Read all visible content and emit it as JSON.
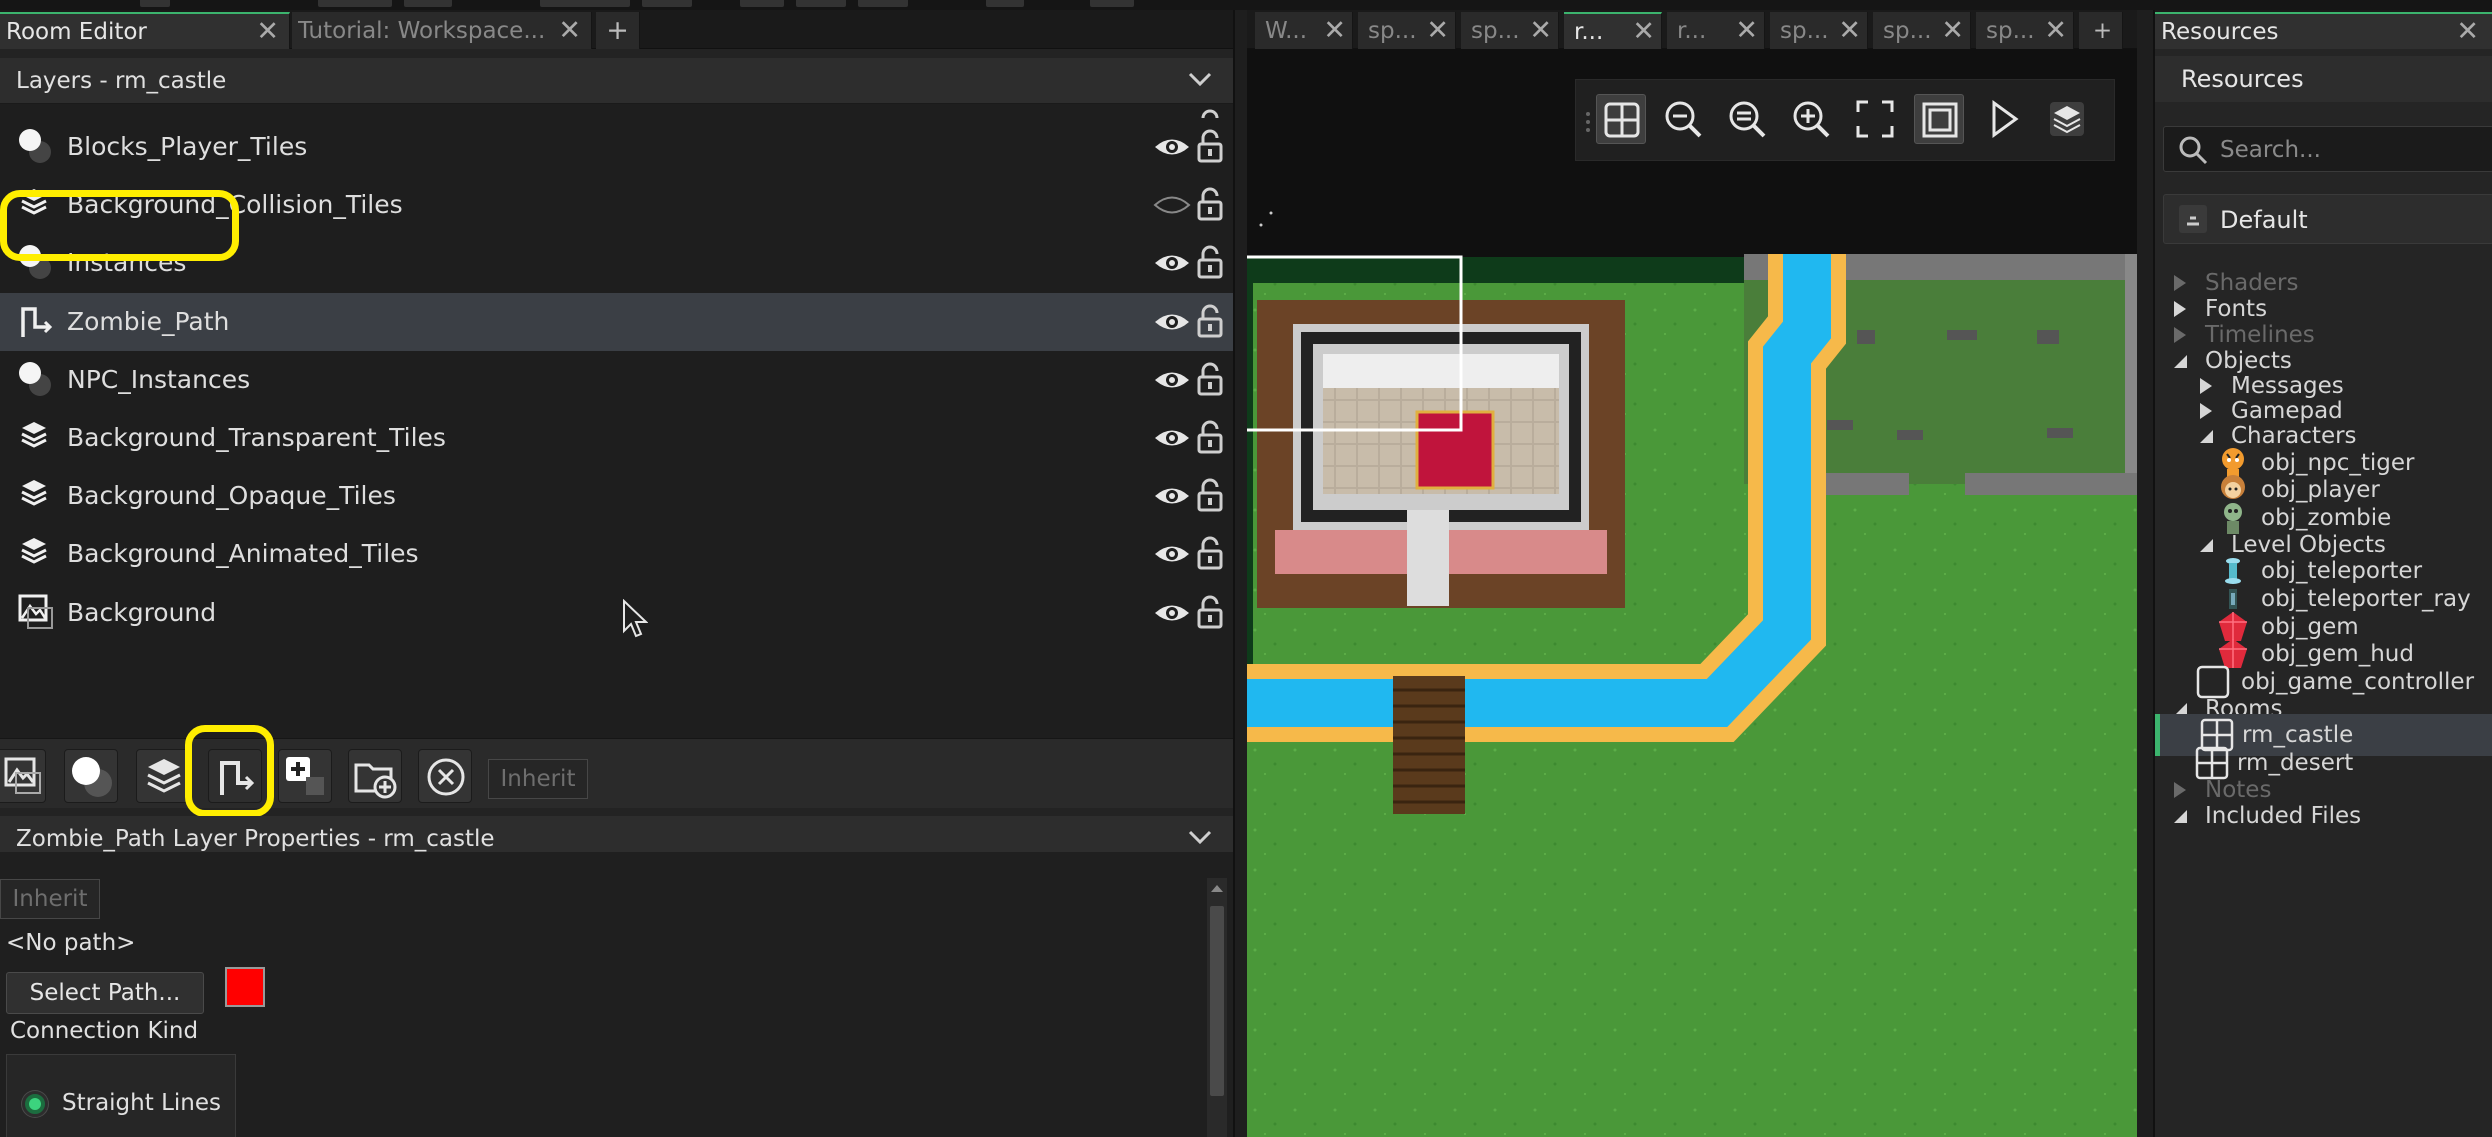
{
  "colors": {
    "accent": "#3cb46e",
    "highlight": "#ffee00",
    "path_color": "#ff0000"
  },
  "left_tabs": [
    {
      "label": "Room Editor",
      "active": true
    },
    {
      "label": "Tutorial: Workspace...",
      "active": false
    },
    {
      "label": "+"
    }
  ],
  "layers_panel": {
    "title": "Layers - rm_castle",
    "layers": [
      {
        "name": "Blocks_Player_Tiles",
        "type": "instance",
        "visible": true
      },
      {
        "name": "Background_Collision_Tiles",
        "type": "tile",
        "visible": false
      },
      {
        "name": "Instances",
        "type": "instance",
        "visible": true
      },
      {
        "name": "Zombie_Path",
        "type": "path",
        "visible": true,
        "selected": true
      },
      {
        "name": "NPC_Instances",
        "type": "instance",
        "visible": true
      },
      {
        "name": "Background_Transparent_Tiles",
        "type": "tile",
        "visible": true
      },
      {
        "name": "Background_Opaque_Tiles",
        "type": "tile",
        "visible": true
      },
      {
        "name": "Background_Animated_Tiles",
        "type": "tile",
        "visible": true
      },
      {
        "name": "Background",
        "type": "background",
        "visible": true
      }
    ],
    "toolbar": {
      "buttons": [
        "add-background-layer",
        "add-instance-layer",
        "add-tile-layer",
        "add-path-layer",
        "add-asset-layer",
        "add-folder",
        "delete-layer"
      ],
      "inherit_label": "Inherit"
    }
  },
  "properties": {
    "title": "Zombie_Path Layer Properties - rm_castle",
    "inherit_label": "Inherit",
    "path_value": "<No path>",
    "select_path_label": "Select Path...",
    "connection_kind_label": "Connection Kind",
    "connection_option": "Straight Lines"
  },
  "room_tabs": [
    {
      "label": "W..."
    },
    {
      "label": "sp..."
    },
    {
      "label": "sp..."
    },
    {
      "label": "r...",
      "active": true
    },
    {
      "label": "r..."
    },
    {
      "label": "sp..."
    },
    {
      "label": "sp..."
    },
    {
      "label": "sp..."
    },
    {
      "label": "+"
    }
  ],
  "room_toolbar": [
    "grid-icon",
    "zoom-out-icon",
    "zoom-reset-icon",
    "zoom-in-icon",
    "fullscreen-icon",
    "frame-icon",
    "play-icon",
    "layers-icon"
  ],
  "resources": {
    "tab_label": "Resources",
    "title": "Resources",
    "search_placeholder": "Search...",
    "filter_label": "Default",
    "tree": [
      {
        "label": "Shaders",
        "level": 0,
        "dim": true,
        "kind": "folder"
      },
      {
        "label": "Fonts",
        "level": 0,
        "kind": "folder"
      },
      {
        "label": "Timelines",
        "level": 0,
        "dim": true,
        "kind": "folder"
      },
      {
        "label": "Objects",
        "level": 0,
        "kind": "folder-open"
      },
      {
        "label": "Messages",
        "level": 1,
        "kind": "folder"
      },
      {
        "label": "Gamepad",
        "level": 1,
        "kind": "folder"
      },
      {
        "label": "Characters",
        "level": 1,
        "kind": "folder-open"
      },
      {
        "label": "obj_npc_tiger",
        "level": 2,
        "kind": "object",
        "icon": "tiger-icon"
      },
      {
        "label": "obj_player",
        "level": 2,
        "kind": "object",
        "icon": "player-icon"
      },
      {
        "label": "obj_zombie",
        "level": 2,
        "kind": "object",
        "icon": "zombie-icon"
      },
      {
        "label": "Level Objects",
        "level": 1,
        "kind": "folder-open"
      },
      {
        "label": "obj_teleporter",
        "level": 2,
        "kind": "object",
        "icon": "teleporter-icon"
      },
      {
        "label": "obj_teleporter_ray",
        "level": 2,
        "kind": "object",
        "icon": "teleporter-ray-icon"
      },
      {
        "label": "obj_gem",
        "level": 2,
        "kind": "object",
        "icon": "gem-icon"
      },
      {
        "label": "obj_gem_hud",
        "level": 2,
        "kind": "object",
        "icon": "gem-icon"
      },
      {
        "label": "obj_game_controller",
        "level": 1,
        "kind": "object",
        "icon": "empty-object-icon"
      },
      {
        "label": "Rooms",
        "level": 0,
        "kind": "folder-open"
      },
      {
        "label": "rm_castle",
        "level": 1,
        "kind": "room",
        "selected": true
      },
      {
        "label": "rm_desert",
        "level": 1,
        "kind": "room"
      },
      {
        "label": "Notes",
        "level": 0,
        "dim": true,
        "kind": "folder"
      },
      {
        "label": "Included Files",
        "level": 0,
        "kind": "folder-open"
      }
    ]
  }
}
